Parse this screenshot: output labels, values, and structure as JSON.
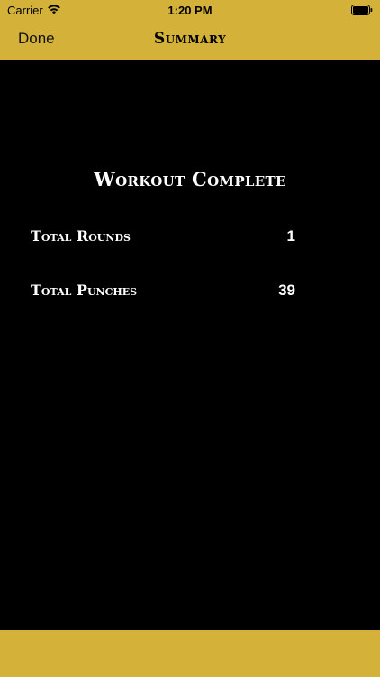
{
  "status_bar": {
    "carrier": "Carrier",
    "time": "1:20 PM"
  },
  "nav": {
    "done_label": "Done",
    "title": "Summary"
  },
  "summary": {
    "heading": "Workout Complete",
    "stats": [
      {
        "label": "Total Rounds",
        "value": "1"
      },
      {
        "label": "Total Punches",
        "value": "39"
      }
    ]
  },
  "colors": {
    "accent": "#d4b23a",
    "background": "#000000",
    "text": "#ffffff"
  },
  "icons": [
    "wifi-icon",
    "battery-icon"
  ]
}
